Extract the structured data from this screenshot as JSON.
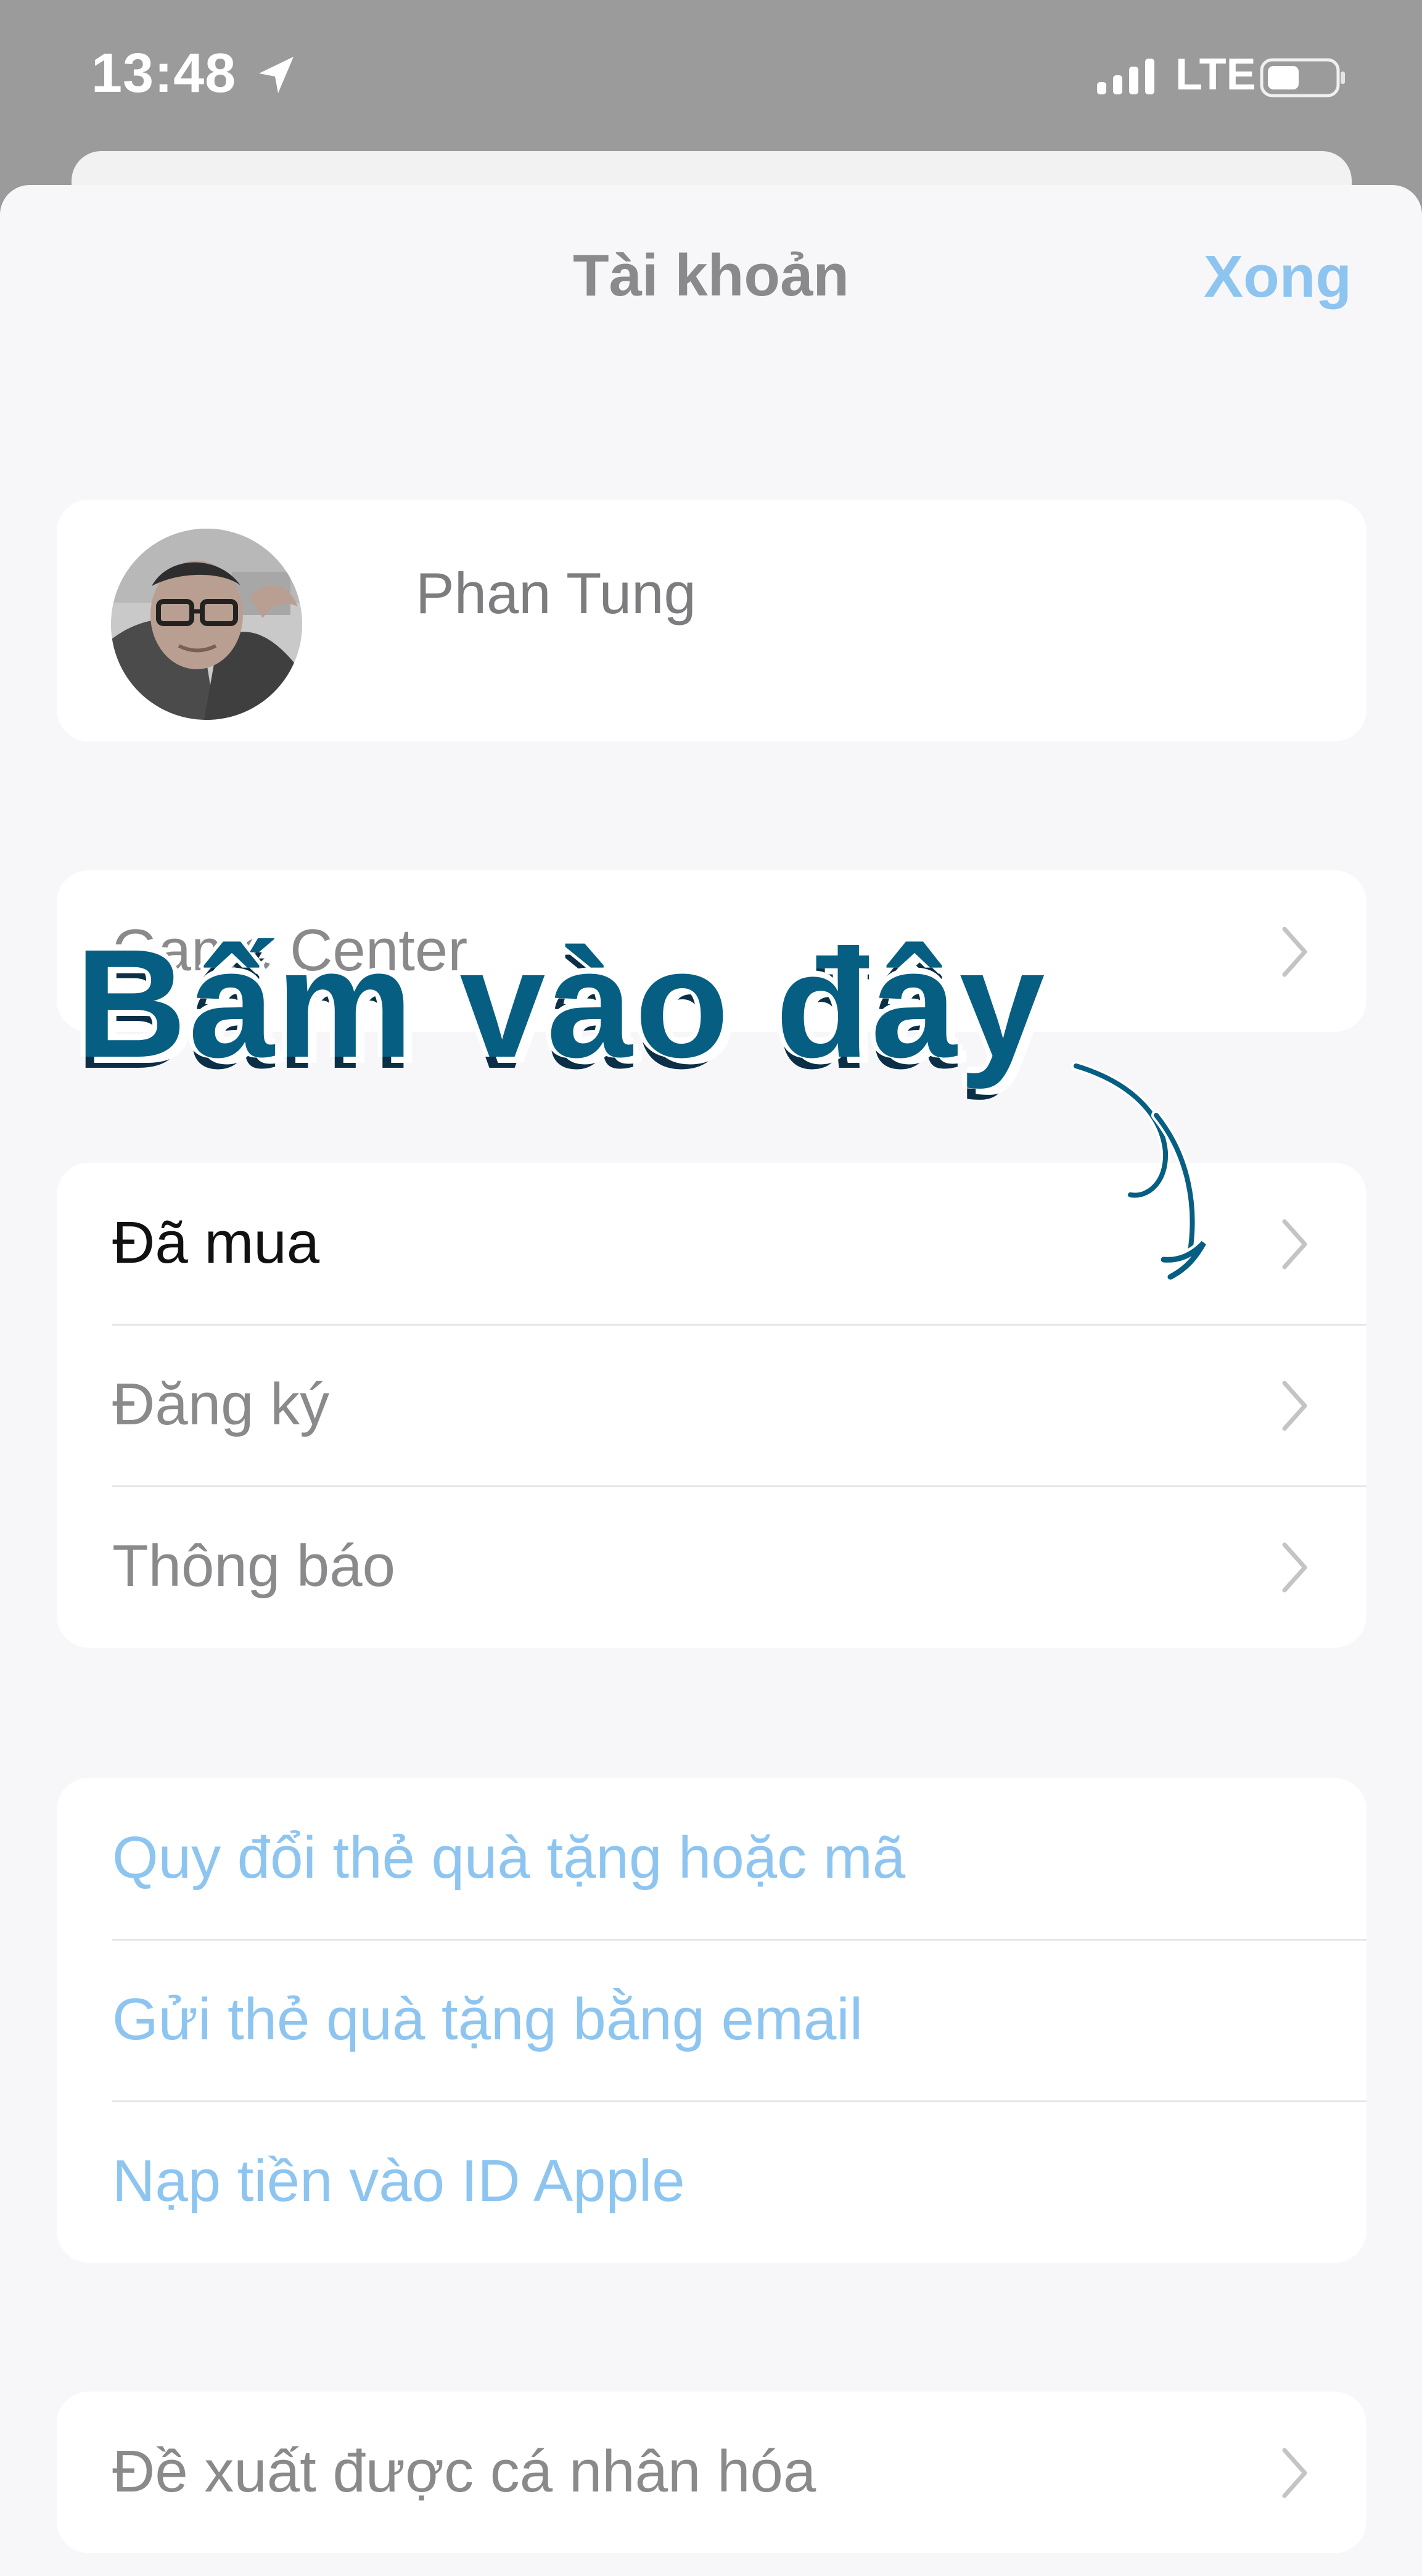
{
  "status_bar": {
    "time": "13:48",
    "network": "LTE",
    "icons": [
      "location-icon",
      "signal-icon",
      "battery-icon"
    ]
  },
  "header": {
    "title": "Tài khoản",
    "done_label": "Xong"
  },
  "profile": {
    "name": "Phan Tung",
    "avatar_icon": "avatar"
  },
  "annotation": {
    "text": "Bấm vào đây",
    "color": "#065f82"
  },
  "sections": {
    "game_center": {
      "label": "Game Center"
    },
    "purchases": {
      "items": [
        {
          "label": "Đã mua"
        },
        {
          "label": "Đăng ký"
        },
        {
          "label": "Thông báo"
        }
      ]
    },
    "gift": {
      "items": [
        {
          "label": "Quy đổi thẻ quà tặng hoặc mã"
        },
        {
          "label": "Gửi thẻ quà tặng bằng email"
        },
        {
          "label": "Nạp tiền vào ID Apple"
        }
      ]
    },
    "personalized": {
      "label": "Đề xuất được cá nhân hóa"
    }
  },
  "colors": {
    "status_bar": "#9b9b9b",
    "sheet_background": "#f7f7f9",
    "card_background": "#ffffff",
    "link_blue": "#8dc5f0",
    "gray_text": "#8a8a8c",
    "active_text": "#111111"
  }
}
